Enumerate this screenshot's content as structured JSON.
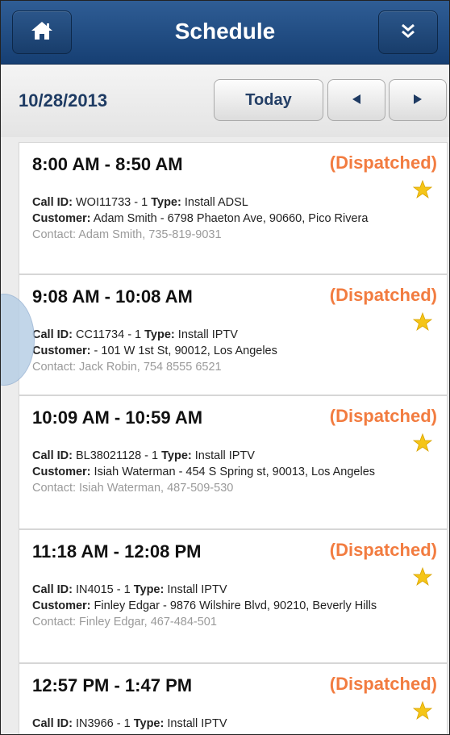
{
  "header": {
    "title": "Schedule",
    "home_icon": "home-icon",
    "menu_icon": "double-chevron-down-icon"
  },
  "datebar": {
    "date": "10/28/2013",
    "today_label": "Today",
    "prev_icon": "triangle-left-icon",
    "next_icon": "triangle-right-icon"
  },
  "colors": {
    "header": "#1f4a80",
    "status": "#f27c40",
    "star": "#f5c518",
    "date_text": "#1e3b63"
  },
  "schedule": [
    {
      "time": "8:00 AM - 8:50 AM",
      "status": "(Dispatched)",
      "call_label": "Call ID:",
      "call_id": "WOI11733 - 1",
      "type_label": "Type:",
      "type": "Install ADSL",
      "customer_label": "Customer:",
      "customer": "Adam Smith - 6798 Phaeton Ave, 90660, Pico Rivera",
      "contact_label": "Contact:",
      "contact": "Adam Smith, 735-819-9031"
    },
    {
      "time": "9:08 AM - 10:08 AM",
      "status": "(Dispatched)",
      "call_label": "Call ID:",
      "call_id": "CC11734 - 1",
      "type_label": "Type:",
      "type": "Install IPTV",
      "customer_label": "Customer:",
      "customer": "- 101 W 1st St, 90012, Los Angeles",
      "contact_label": "Contact:",
      "contact": "Jack Robin, 754 8555 6521"
    },
    {
      "time": "10:09 AM - 10:59 AM",
      "status": "(Dispatched)",
      "call_label": "Call ID:",
      "call_id": "BL38021128 - 1",
      "type_label": "Type:",
      "type": "Install IPTV",
      "customer_label": "Customer:",
      "customer": "Isiah Waterman - 454 S Spring st, 90013, Los Angeles",
      "contact_label": "Contact:",
      "contact": "Isiah Waterman, 487-509-530"
    },
    {
      "time": "11:18 AM - 12:08 PM",
      "status": "(Dispatched)",
      "call_label": "Call ID:",
      "call_id": "IN4015 - 1",
      "type_label": "Type:",
      "type": "Install IPTV",
      "customer_label": "Customer:",
      "customer": "Finley Edgar - 9876 Wilshire Blvd, 90210, Beverly Hills",
      "contact_label": "Contact:",
      "contact": "Finley Edgar, 467-484-501"
    },
    {
      "time": "12:57 PM - 1:47 PM",
      "status": "(Dispatched)",
      "call_label": "Call ID:",
      "call_id": "IN3966 - 1",
      "type_label": "Type:",
      "type": "Install IPTV",
      "customer_label": "",
      "customer": "",
      "contact_label": "",
      "contact": ""
    }
  ]
}
